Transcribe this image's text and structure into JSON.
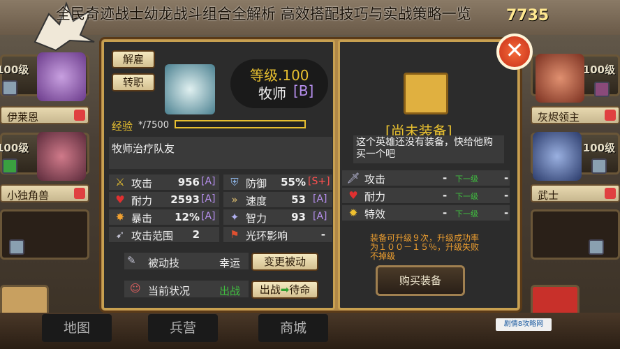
{
  "header": {
    "title": "全民奇迹战士幼龙战斗组合全解析 高效搭配技巧与实战策略一览",
    "gold": "7735"
  },
  "left_slots": [
    {
      "level": "100级",
      "name": "伊莱恩",
      "color": "#8a5aa0"
    },
    {
      "level": "100级",
      "name": "小独角兽",
      "color": "#a04a5a"
    },
    {
      "level": "100级",
      "name": ""
    }
  ],
  "right_slots": [
    {
      "level": "100级",
      "name": "灰烬领主",
      "color": "#a05030"
    },
    {
      "level": "100级",
      "name": "武士",
      "color": "#5a6a9a"
    },
    {
      "level": "",
      "name": ""
    }
  ],
  "hero": {
    "dismiss": "解雇",
    "transfer": "转职",
    "level_label": "等级.100",
    "class": "牧师",
    "grade": "[B]",
    "exp_label": "经验",
    "exp_value": "*/7500",
    "exp_fill": 0,
    "description": "牧师治疗队友",
    "stats": [
      {
        "icon": "attack-icon",
        "label": "攻击",
        "value": "956",
        "grade": "[A]"
      },
      {
        "icon": "defense-icon",
        "label": "防御",
        "value": "55%",
        "grade": "[S+]"
      },
      {
        "icon": "hp-icon",
        "label": "耐力",
        "value": "2593",
        "grade": "[A]"
      },
      {
        "icon": "speed-icon",
        "label": "速度",
        "value": "53",
        "grade": "[A]"
      },
      {
        "icon": "crit-icon",
        "label": "暴击",
        "value": "12%",
        "grade": "[A]"
      },
      {
        "icon": "int-icon",
        "label": "智力",
        "value": "93",
        "grade": "[A]"
      },
      {
        "icon": "range-icon",
        "label": "攻击范围",
        "value": "2",
        "grade": ""
      },
      {
        "icon": "aura-icon",
        "label": "光环影响",
        "value": "-",
        "grade": ""
      }
    ],
    "passive_label": "被动技",
    "passive_value": "幸运",
    "change_passive": "变更被动",
    "status_label": "当前状况",
    "status_value": "出战",
    "status_btn_a": "出战",
    "status_btn_b": "待命"
  },
  "equipment": {
    "state": "[尚未装备]",
    "note": "这个英雄还没有装备，快给他购买一个吧",
    "rows": [
      {
        "icon": "sword-icon",
        "label": "攻击",
        "cur": "-",
        "next": "下一级",
        "nval": "-"
      },
      {
        "icon": "heart-icon",
        "label": "耐力",
        "cur": "-",
        "next": "下一级",
        "nval": "-"
      },
      {
        "icon": "special-icon",
        "label": "特效",
        "cur": "-",
        "next": "下一级",
        "nval": "-"
      }
    ],
    "upgrade_note_1": "装备可升级９次，升级成功率",
    "upgrade_note_2": "为１００－１５％，升级失败",
    "upgrade_note_3": "不掉级",
    "buy": "购买装备"
  },
  "bottom": {
    "tabs": [
      "地图",
      "兵营",
      "商城"
    ],
    "watermark": "剧情8攻略网"
  },
  "colors": {
    "accent": "#ffd040",
    "grade": "#b890f0",
    "red_grade": "#ff5050",
    "green": "#40c040"
  }
}
